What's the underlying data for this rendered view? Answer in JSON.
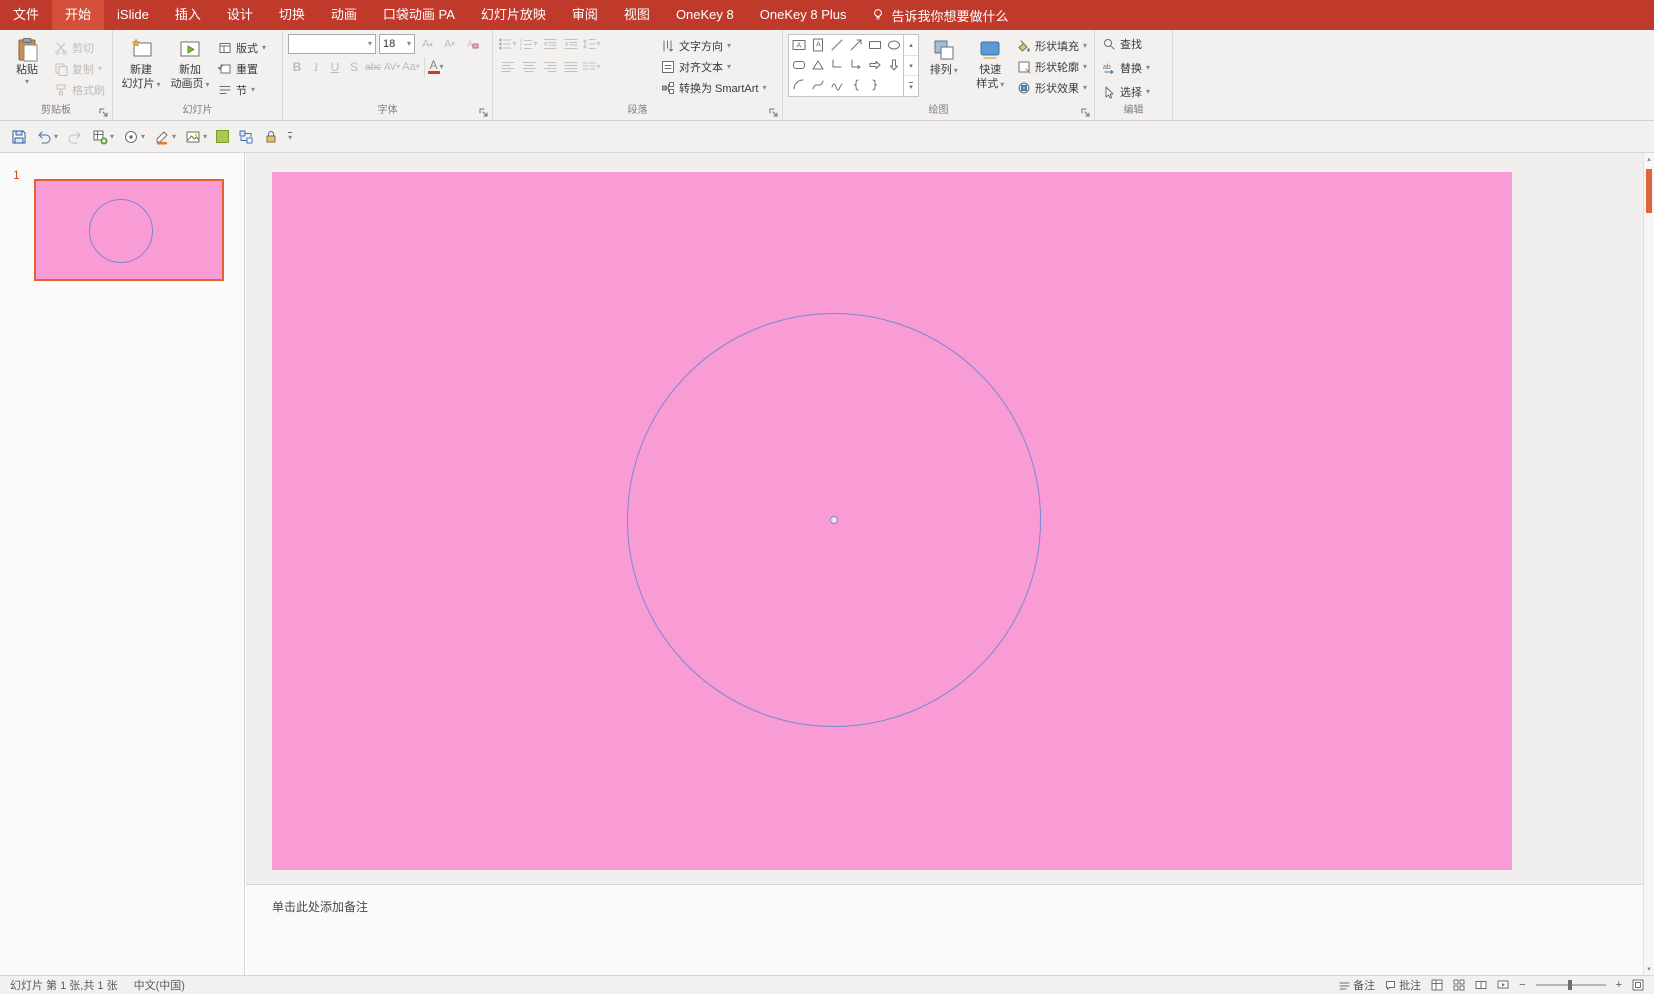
{
  "icons": {
    "dropdown": "▾",
    "up": "▴"
  },
  "tabbar": {
    "tabs": [
      "文件",
      "开始",
      "iSlide",
      "插入",
      "设计",
      "切换",
      "动画",
      "口袋动画 PA",
      "幻灯片放映",
      "审阅",
      "视图",
      "OneKey 8",
      "OneKey 8 Plus"
    ],
    "tell_me": "告诉我你想要做什么"
  },
  "ribbon": {
    "clipboard": {
      "label": "剪贴板",
      "paste": "粘贴",
      "cut": "剪切",
      "copy": "复制",
      "format_painter": "格式刷"
    },
    "slides": {
      "label": "幻灯片",
      "new_slide_line1": "新建",
      "new_slide_line2": "幻灯片",
      "new_anim_line1": "新加",
      "new_anim_line2": "动画页",
      "layout": "版式",
      "reset": "重置",
      "section": "节"
    },
    "font": {
      "label": "字体",
      "font_name_value": "",
      "font_size_value": "18",
      "bold": "B",
      "italic": "I",
      "underline": "U",
      "shadow": "S",
      "strikethrough": "abc",
      "char_spacing": "AV",
      "change_case": "Aa",
      "font_color": "A"
    },
    "paragraph": {
      "label": "段落",
      "text_direction": "文字方向",
      "align_text": "对齐文本",
      "convert_smartart": "转换为 SmartArt"
    },
    "drawing": {
      "label": "绘图",
      "arrange": "排列",
      "quick_styles_line1": "快速",
      "quick_styles_line2": "样式",
      "shape_fill": "形状填充",
      "shape_outline": "形状轮廓",
      "shape_effects": "形状效果"
    },
    "editing": {
      "label": "编辑",
      "find": "查找",
      "replace": "替换",
      "select": "选择"
    }
  },
  "qat_icon_names": [
    "save",
    "undo",
    "redo",
    "paste-special",
    "shape-tool",
    "color-picker",
    "picture-tool",
    "fill-color",
    "swap-shape",
    "lock",
    "more"
  ],
  "slide_panel": {
    "slide_number": "1"
  },
  "canvas": {
    "slide_background": "#f99bd5",
    "circle_outline": "#7789d4",
    "selection_border": "#e8612c"
  },
  "notes": {
    "placeholder": "单击此处添加备注"
  },
  "status_bar": {
    "slide_info": "幻灯片 第 1 张,共 1 张",
    "language": "中文(中国)",
    "notes_toggle": "备注",
    "comments_toggle": "批注",
    "zoom_out": "−",
    "zoom_in": "+"
  }
}
